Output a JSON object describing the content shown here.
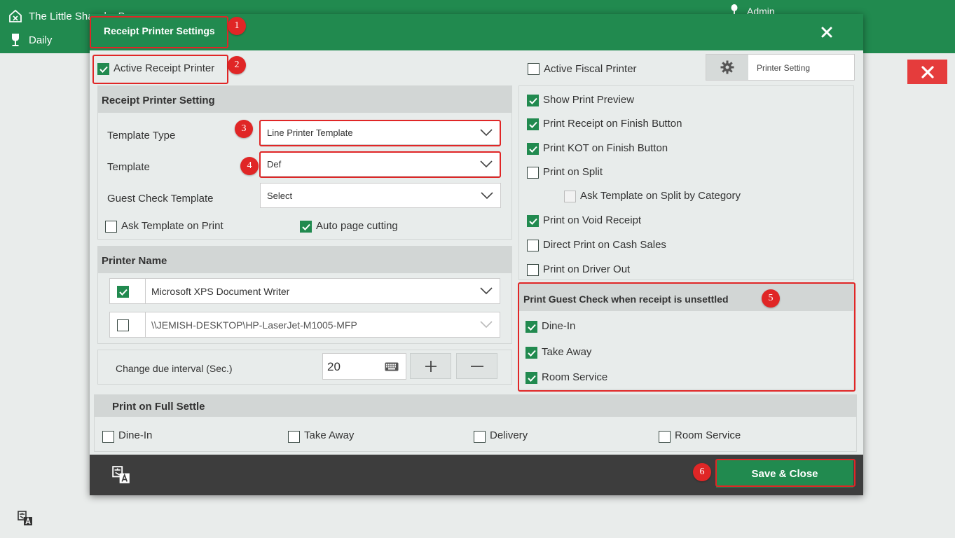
{
  "app": {
    "title": "The Little Sha…ka B…",
    "subtitle": "Daily",
    "user": "Admin"
  },
  "modal": {
    "title": "Receipt Printer Settings",
    "active_receipt_printer": {
      "label": "Active Receipt Printer",
      "checked": true
    },
    "active_fiscal_printer": {
      "label": "Active Fiscal Printer",
      "checked": false
    },
    "printer_setting_button": "Printer Setting",
    "receipt_printer_setting": {
      "heading": "Receipt Printer Setting",
      "template_type_label": "Template Type",
      "template_type_value": "Line Printer Template",
      "template_label": "Template",
      "template_value": "Def",
      "guest_check_template_label": "Guest Check Template",
      "guest_check_template_value": "Select",
      "ask_template_on_print": {
        "label": "Ask Template on Print",
        "checked": false
      },
      "auto_page_cutting": {
        "label": "Auto page cutting",
        "checked": true
      }
    },
    "printer_name": {
      "heading": "Printer Name",
      "printers": [
        {
          "name": "Microsoft XPS Document Writer",
          "checked": true
        },
        {
          "name": "\\\\JEMISH-DESKTOP\\HP-LaserJet-M1005-MFP",
          "checked": false
        }
      ]
    },
    "change_due": {
      "label": "Change due interval (Sec.)",
      "value": "20"
    },
    "options": [
      {
        "label": "Show Print Preview",
        "checked": true
      },
      {
        "label": "Print Receipt on Finish Button",
        "checked": true
      },
      {
        "label": "Print KOT on Finish Button",
        "checked": true
      },
      {
        "label": "Print on Split",
        "checked": false
      },
      {
        "label": "Ask Template on Split by Category",
        "checked": false,
        "disabled": true
      },
      {
        "label": "Print on Void Receipt",
        "checked": true
      },
      {
        "label": "Direct Print on Cash Sales",
        "checked": false
      },
      {
        "label": "Print on Driver Out",
        "checked": false
      }
    ],
    "guest_check": {
      "heading": "Print Guest Check when receipt is unsettled",
      "items": [
        {
          "label": "Dine-In",
          "checked": true
        },
        {
          "label": "Take Away",
          "checked": true
        },
        {
          "label": "Room Service",
          "checked": true
        }
      ]
    },
    "full_settle": {
      "heading": "Print on Full Settle",
      "items": [
        {
          "label": "Dine-In",
          "checked": false
        },
        {
          "label": "Take Away",
          "checked": false
        },
        {
          "label": "Delivery",
          "checked": false
        },
        {
          "label": "Room Service",
          "checked": false
        }
      ]
    },
    "save_button": "Save & Close"
  },
  "annotations": [
    "1",
    "2",
    "3",
    "4",
    "5",
    "6"
  ],
  "colors": {
    "brand": "#218a4f",
    "annotation": "#e02626",
    "close": "#e53c3c",
    "footer": "#3d3d3d"
  },
  "icons": [
    "home-icon",
    "wine-glass-icon",
    "user-icon",
    "close-icon",
    "gear-icon",
    "keyboard-icon",
    "plus-icon",
    "minus-icon",
    "chevron-down-icon",
    "translate-icon",
    "checkmark-icon"
  ]
}
